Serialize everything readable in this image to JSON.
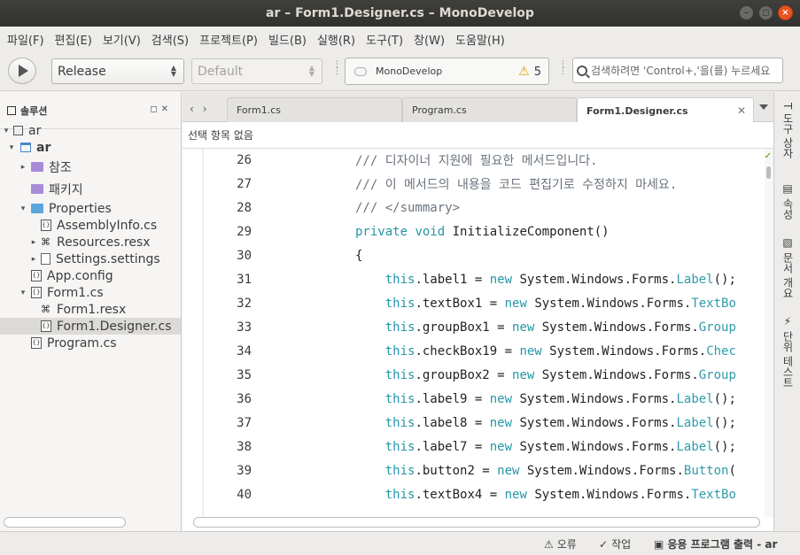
{
  "window": {
    "title": "ar – Form1.Designer.cs – MonoDevelop",
    "controls": [
      "–",
      "◻",
      "×"
    ]
  },
  "menu": [
    "파일(F)",
    "편집(E)",
    "보기(V)",
    "검색(S)",
    "프로젝트(P)",
    "빌드(B)",
    "실행(R)",
    "도구(T)",
    "창(W)",
    "도움말(H)"
  ],
  "toolbar": {
    "configuration": "Release",
    "platform": "Default",
    "status_text": "MonoDevelop",
    "warning_count": "5",
    "search_placeholder": "검색하려면 'Control+,'을(를) 누르세요"
  },
  "solution_pad": {
    "title": "솔루션",
    "items": [
      {
        "label": "ar",
        "icon": "solution-icon",
        "expander": "▾"
      },
      {
        "label": "ar",
        "icon": "project-icon",
        "expander": "▾"
      },
      {
        "label": "참조",
        "icon": "references-icon",
        "expander": "▸"
      },
      {
        "label": "패키지",
        "icon": "packages-icon",
        "expander": ""
      },
      {
        "label": "Properties",
        "icon": "folder-icon",
        "expander": "▾"
      },
      {
        "label": "AssemblyInfo.cs",
        "icon": "code-file-icon",
        "expander": ""
      },
      {
        "label": "Resources.resx",
        "icon": "resource-file-icon",
        "expander": "▸"
      },
      {
        "label": "Settings.settings",
        "icon": "file-icon",
        "expander": "▸"
      },
      {
        "label": "App.config",
        "icon": "code-file-icon",
        "expander": ""
      },
      {
        "label": "Form1.cs",
        "icon": "code-file-icon",
        "expander": "▾"
      },
      {
        "label": "Form1.resx",
        "icon": "resource-file-icon",
        "expander": ""
      },
      {
        "label": "Form1.Designer.cs",
        "icon": "code-file-icon",
        "expander": ""
      },
      {
        "label": "Program.cs",
        "icon": "code-file-icon",
        "expander": ""
      }
    ]
  },
  "editor": {
    "tabs": [
      "Form1.cs",
      "Program.cs",
      "Form1.Designer.cs"
    ],
    "active_tab": "Form1.Designer.cs",
    "breadcrumb": "선택 항목 없음",
    "lines": [
      {
        "n": "26",
        "parts": [
          {
            "t": "/// 디자이너 지원에 필요한 메서드입니다.",
            "c": "com"
          }
        ]
      },
      {
        "n": "27",
        "parts": [
          {
            "t": "/// 이 메서드의 내용을 코드 편집기로 수정하지 마세요.",
            "c": "com"
          }
        ]
      },
      {
        "n": "28",
        "parts": [
          {
            "t": "/// </summary>",
            "c": "com"
          }
        ]
      },
      {
        "n": "29",
        "parts": [
          {
            "t": "private",
            "c": "kw"
          },
          {
            "t": " ",
            "c": "tx"
          },
          {
            "t": "void",
            "c": "kw"
          },
          {
            "t": " InitializeComponent()",
            "c": "tx"
          }
        ]
      },
      {
        "n": "30",
        "parts": [
          {
            "t": "{",
            "c": "tx"
          }
        ]
      },
      {
        "n": "31",
        "parts": [
          {
            "t": "    ",
            "c": "tx"
          },
          {
            "t": "this",
            "c": "kw"
          },
          {
            "t": ".label1 = ",
            "c": "tx"
          },
          {
            "t": "new",
            "c": "kw"
          },
          {
            "t": " System.Windows.Forms.",
            "c": "tx"
          },
          {
            "t": "Label",
            "c": "ty"
          },
          {
            "t": "();",
            "c": "tx"
          }
        ]
      },
      {
        "n": "32",
        "parts": [
          {
            "t": "    ",
            "c": "tx"
          },
          {
            "t": "this",
            "c": "kw"
          },
          {
            "t": ".textBox1 = ",
            "c": "tx"
          },
          {
            "t": "new",
            "c": "kw"
          },
          {
            "t": " System.Windows.Forms.",
            "c": "tx"
          },
          {
            "t": "TextBo",
            "c": "ty"
          }
        ]
      },
      {
        "n": "33",
        "parts": [
          {
            "t": "    ",
            "c": "tx"
          },
          {
            "t": "this",
            "c": "kw"
          },
          {
            "t": ".groupBox1 = ",
            "c": "tx"
          },
          {
            "t": "new",
            "c": "kw"
          },
          {
            "t": " System.Windows.Forms.",
            "c": "tx"
          },
          {
            "t": "Group",
            "c": "ty"
          }
        ]
      },
      {
        "n": "34",
        "parts": [
          {
            "t": "    ",
            "c": "tx"
          },
          {
            "t": "this",
            "c": "kw"
          },
          {
            "t": ".checkBox19 = ",
            "c": "tx"
          },
          {
            "t": "new",
            "c": "kw"
          },
          {
            "t": " System.Windows.Forms.",
            "c": "tx"
          },
          {
            "t": "Chec",
            "c": "ty"
          }
        ]
      },
      {
        "n": "35",
        "parts": [
          {
            "t": "    ",
            "c": "tx"
          },
          {
            "t": "this",
            "c": "kw"
          },
          {
            "t": ".groupBox2 = ",
            "c": "tx"
          },
          {
            "t": "new",
            "c": "kw"
          },
          {
            "t": " System.Windows.Forms.",
            "c": "tx"
          },
          {
            "t": "Group",
            "c": "ty"
          }
        ]
      },
      {
        "n": "36",
        "parts": [
          {
            "t": "    ",
            "c": "tx"
          },
          {
            "t": "this",
            "c": "kw"
          },
          {
            "t": ".label9 = ",
            "c": "tx"
          },
          {
            "t": "new",
            "c": "kw"
          },
          {
            "t": " System.Windows.Forms.",
            "c": "tx"
          },
          {
            "t": "Label",
            "c": "ty"
          },
          {
            "t": "();",
            "c": "tx"
          }
        ]
      },
      {
        "n": "37",
        "parts": [
          {
            "t": "    ",
            "c": "tx"
          },
          {
            "t": "this",
            "c": "kw"
          },
          {
            "t": ".label8 = ",
            "c": "tx"
          },
          {
            "t": "new",
            "c": "kw"
          },
          {
            "t": " System.Windows.Forms.",
            "c": "tx"
          },
          {
            "t": "Label",
            "c": "ty"
          },
          {
            "t": "();",
            "c": "tx"
          }
        ]
      },
      {
        "n": "38",
        "parts": [
          {
            "t": "    ",
            "c": "tx"
          },
          {
            "t": "this",
            "c": "kw"
          },
          {
            "t": ".label7 = ",
            "c": "tx"
          },
          {
            "t": "new",
            "c": "kw"
          },
          {
            "t": " System.Windows.Forms.",
            "c": "tx"
          },
          {
            "t": "Label",
            "c": "ty"
          },
          {
            "t": "();",
            "c": "tx"
          }
        ]
      },
      {
        "n": "39",
        "parts": [
          {
            "t": "    ",
            "c": "tx"
          },
          {
            "t": "this",
            "c": "kw"
          },
          {
            "t": ".button2 = ",
            "c": "tx"
          },
          {
            "t": "new",
            "c": "kw"
          },
          {
            "t": " System.Windows.Forms.",
            "c": "tx"
          },
          {
            "t": "Button",
            "c": "ty"
          },
          {
            "t": "(",
            "c": "tx"
          }
        ]
      },
      {
        "n": "40",
        "parts": [
          {
            "t": "    ",
            "c": "tx"
          },
          {
            "t": "this",
            "c": "kw"
          },
          {
            "t": ".textBox4 = ",
            "c": "tx"
          },
          {
            "t": "new",
            "c": "kw"
          },
          {
            "t": " System.Windows.Forms.",
            "c": "tx"
          },
          {
            "t": "TextBo",
            "c": "ty"
          }
        ]
      }
    ]
  },
  "right_dock": [
    "도구 상자",
    "속성",
    "문서 개요",
    "단위 테스트"
  ],
  "status_bar": {
    "errors": "오류",
    "tasks": "작업",
    "output": "응용 프로그램 출력 - ar"
  },
  "colors": {
    "keyword": "#2496a7",
    "comment": "#6a737d",
    "accent_close": "#e95420",
    "warning": "#e6a000"
  }
}
